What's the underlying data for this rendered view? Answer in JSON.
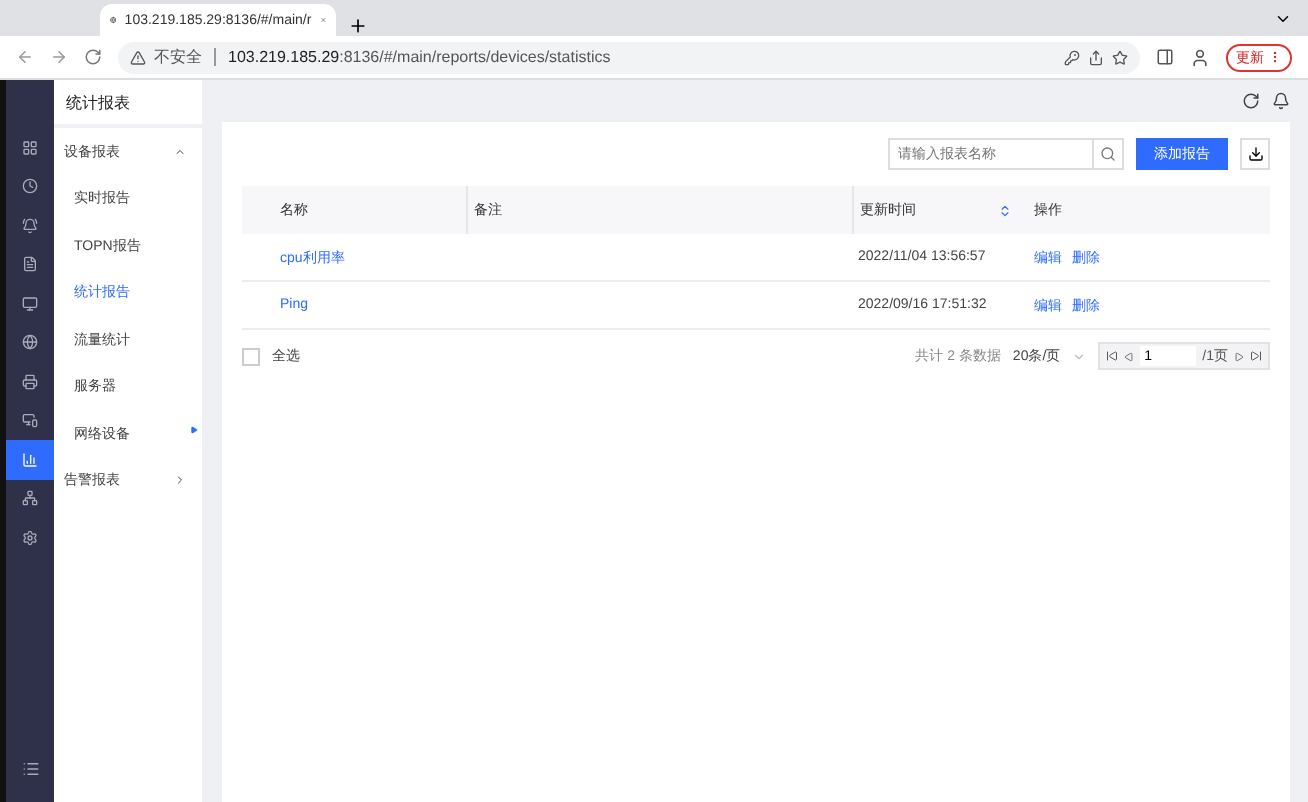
{
  "browser": {
    "tab_title": "103.219.185.29:8136/#/main/r",
    "security": "不安全",
    "url_host": "103.219.185.29",
    "url_rest": ":8136/#/main/reports/devices/statistics",
    "update_button": "更新"
  },
  "rail": [
    {
      "selected": false
    },
    {
      "selected": false
    },
    {
      "selected": false
    },
    {
      "selected": false
    },
    {
      "selected": false
    },
    {
      "selected": false
    },
    {
      "selected": false
    },
    {
      "selected": false
    },
    {
      "selected": true
    },
    {
      "selected": false
    },
    {
      "selected": false
    }
  ],
  "sidebar": {
    "title": "统计报表",
    "groups": [
      {
        "label": "设备报表",
        "expanded": true,
        "children": [
          {
            "label": "实时报告",
            "selected": false
          },
          {
            "label": "TOPN报告",
            "selected": false
          },
          {
            "label": "统计报告",
            "selected": true
          },
          {
            "label": "流量统计",
            "selected": false
          },
          {
            "label": "服务器",
            "selected": false
          },
          {
            "label": "网络设备",
            "selected": false
          }
        ]
      },
      {
        "label": "告警报表",
        "expanded": false
      }
    ]
  },
  "toolbar": {
    "search_placeholder": "请输入报表名称",
    "add_button": "添加报告"
  },
  "table": {
    "columns": [
      "名称",
      "备注",
      "更新时间",
      "操作"
    ],
    "rows": [
      {
        "name": "cpu利用率",
        "note": "",
        "updated": "2022/11/04 13:56:57",
        "actions": [
          "编辑",
          "删除"
        ]
      },
      {
        "name": "Ping",
        "note": "",
        "updated": "2022/09/16 17:51:32",
        "actions": [
          "编辑",
          "删除"
        ]
      }
    ]
  },
  "footer": {
    "select_all": "全选",
    "checked": false,
    "total": "共计 2 条数据",
    "page_size": "20条/页",
    "page": "1",
    "pages": "/1页"
  }
}
